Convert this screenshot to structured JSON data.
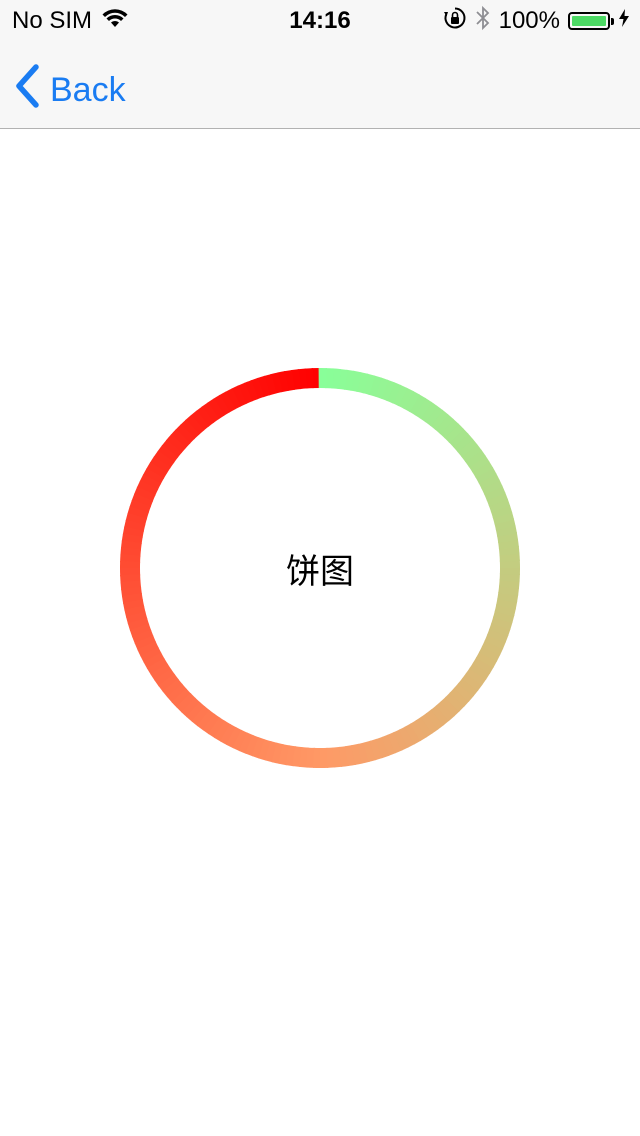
{
  "status_bar": {
    "carrier": "No SIM",
    "time": "14:16",
    "battery_percent": "100%",
    "battery_level": 1.0,
    "icons": [
      "wifi-icon",
      "rotation-lock-icon",
      "bluetooth-icon",
      "battery-icon",
      "charging-icon"
    ]
  },
  "nav": {
    "back_label": "Back"
  },
  "chart": {
    "center_label": "饼图",
    "colors": {
      "start": "#ff0000",
      "mid": "#ff9966",
      "end": "#88ff99"
    }
  },
  "colors": {
    "accent": "#1a7cf2",
    "battery_green": "#4cd964",
    "bar_background": "#f7f7f7"
  }
}
